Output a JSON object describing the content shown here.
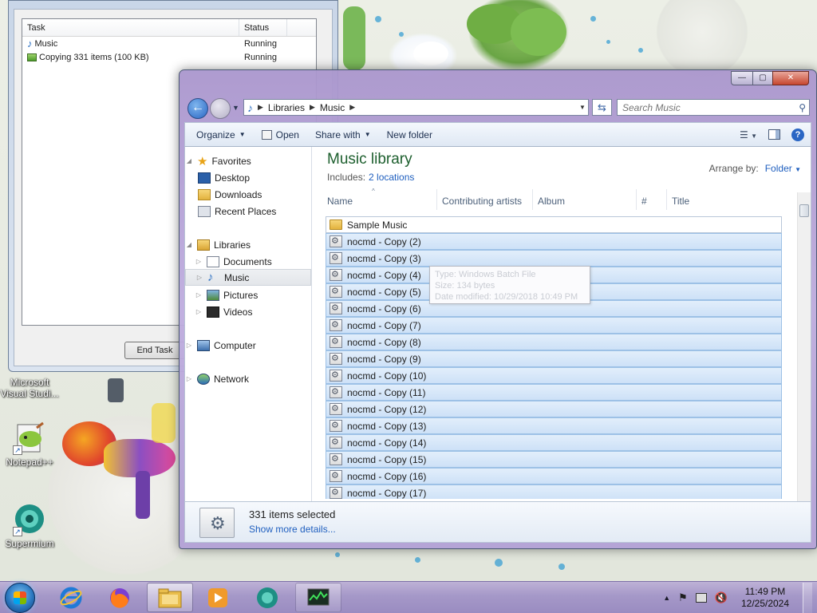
{
  "desktop": {
    "icons": [
      {
        "label": "Microsoft Visual Studi...",
        "icon": "visual-studio-icon"
      },
      {
        "label": "Notepad++",
        "icon": "notepad-plus-plus-icon"
      },
      {
        "label": "Supermium",
        "icon": "supermium-icon"
      }
    ]
  },
  "task_manager": {
    "columns": [
      "Task",
      "Status"
    ],
    "rows": [
      {
        "task": "Music",
        "status": "Running",
        "icon": "music-library-icon"
      },
      {
        "task": "Copying 331 items (100 KB)",
        "status": "Running",
        "icon": "copy-progress-icon"
      }
    ],
    "end_task_label": "End Task"
  },
  "explorer": {
    "window_buttons": {
      "minimize": "—",
      "maximize": "▢",
      "close": "✕"
    },
    "breadcrumb": [
      "Libraries",
      "Music"
    ],
    "search_placeholder": "Search Music",
    "toolbar": {
      "organize": "Organize",
      "open": "Open",
      "share_with": "Share with",
      "new_folder": "New folder"
    },
    "nav": {
      "favorites": "Favorites",
      "desktop": "Desktop",
      "downloads": "Downloads",
      "recent_places": "Recent Places",
      "libraries": "Libraries",
      "documents": "Documents",
      "music": "Music",
      "pictures": "Pictures",
      "videos": "Videos",
      "computer": "Computer",
      "network": "Network"
    },
    "library": {
      "title": "Music library",
      "includes_label": "Includes:",
      "includes_link": "2 locations",
      "arrange_label": "Arrange by:",
      "arrange_value": "Folder"
    },
    "columns": [
      "Name",
      "Contributing artists",
      "Album",
      "#",
      "Title"
    ],
    "files": [
      {
        "name": "Sample Music",
        "type": "folder",
        "selected": false
      },
      {
        "name": "nocmd - Copy (2)",
        "type": "batch",
        "selected": true
      },
      {
        "name": "nocmd - Copy (3)",
        "type": "batch",
        "selected": true
      },
      {
        "name": "nocmd - Copy (4)",
        "type": "batch",
        "selected": true
      },
      {
        "name": "nocmd - Copy (5)",
        "type": "batch",
        "selected": true
      },
      {
        "name": "nocmd - Copy (6)",
        "type": "batch",
        "selected": true
      },
      {
        "name": "nocmd - Copy (7)",
        "type": "batch",
        "selected": true
      },
      {
        "name": "nocmd - Copy (8)",
        "type": "batch",
        "selected": true
      },
      {
        "name": "nocmd - Copy (9)",
        "type": "batch",
        "selected": true
      },
      {
        "name": "nocmd - Copy (10)",
        "type": "batch",
        "selected": true
      },
      {
        "name": "nocmd - Copy (11)",
        "type": "batch",
        "selected": true
      },
      {
        "name": "nocmd - Copy (12)",
        "type": "batch",
        "selected": true
      },
      {
        "name": "nocmd - Copy (13)",
        "type": "batch",
        "selected": true
      },
      {
        "name": "nocmd - Copy (14)",
        "type": "batch",
        "selected": true
      },
      {
        "name": "nocmd - Copy (15)",
        "type": "batch",
        "selected": true
      },
      {
        "name": "nocmd - Copy (16)",
        "type": "batch",
        "selected": true
      },
      {
        "name": "nocmd - Copy (17)",
        "type": "batch",
        "selected": true
      }
    ],
    "tooltip": {
      "type": "Type: Windows Batch File",
      "size": "Size: 134 bytes",
      "date": "Date modified: 10/29/2018 10:49 PM"
    },
    "details": {
      "count": "331 items selected",
      "more": "Show more details..."
    }
  },
  "taskbar": {
    "apps": [
      "internet-explorer-icon",
      "firefox-icon",
      "file-explorer-icon",
      "media-player-icon",
      "supermium-icon",
      "task-manager-icon"
    ],
    "clock_time": "11:49 PM",
    "clock_date": "12/25/2024"
  },
  "colors": {
    "selection_bg": "#cde1f7",
    "library_title": "#1d5f2e",
    "link": "#1f5fbf",
    "window_frame": "#b6a2d8"
  }
}
